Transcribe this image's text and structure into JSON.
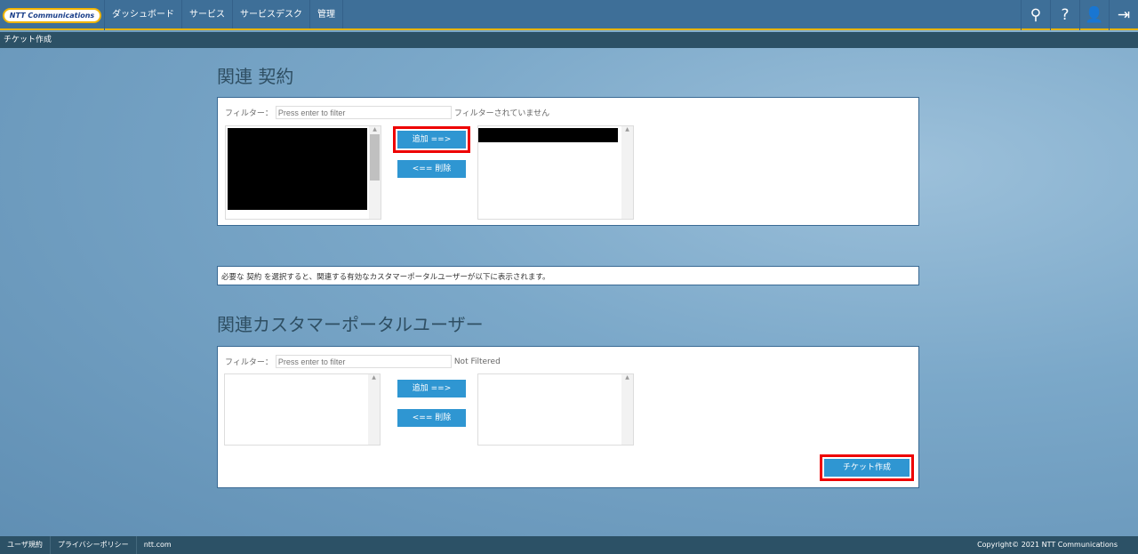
{
  "header": {
    "logo": "NTT Communications",
    "nav": [
      "ダッシュボード",
      "サービス",
      "サービスデスク",
      "管理"
    ]
  },
  "subheader": "チケット作成",
  "contracts": {
    "title": "関連 契約",
    "filter_label": "フィルター：",
    "filter_placeholder": "Press enter to filter",
    "filter_status": "フィルターされていません",
    "add": "追加 ==>",
    "remove": "<== 削除"
  },
  "notice": "必要な 契約 を選択すると、関連する有効なカスタマーポータルユーザーが以下に表示されます。",
  "users": {
    "title": "関連カスタマーポータルユーザー",
    "filter_label": "フィルター：",
    "filter_placeholder": "Press enter to filter",
    "filter_status": "Not Filtered",
    "add": "追加 ==>",
    "remove": "<== 削除",
    "create": "チケット作成"
  },
  "footer": {
    "links": [
      "ユーザ規約",
      "プライバシーポリシー",
      "ntt.com"
    ],
    "copyright": "Copyright© 2021 NTT Communications"
  }
}
